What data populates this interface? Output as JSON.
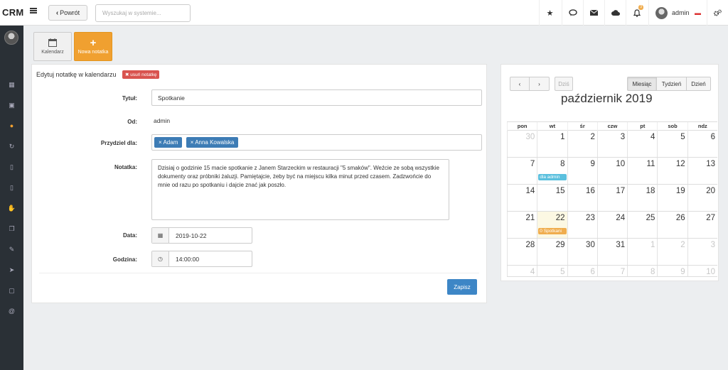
{
  "app": {
    "logo": "CRM"
  },
  "topbar": {
    "back_label": "Powrót",
    "search_placeholder": "Wyszukaj w systemie...",
    "notif_count": "3",
    "user_name": "admin",
    "icons": [
      "star-icon",
      "chat-icon",
      "envelope-icon",
      "cloud-icon",
      "bell-icon",
      "cogs-icon"
    ]
  },
  "tiles": {
    "calendar_label": "Kalendarz",
    "new_note_label": "Nowa notatka"
  },
  "form": {
    "title": "Edytuj notatkę w kalendarzu",
    "delete_label": "✖ usuń notatkę",
    "title_label": "Tytuł:",
    "title_value": "Spotkanie",
    "from_label": "Od:",
    "from_value": "admin",
    "assign_label": "Przydziel dla:",
    "assignees": [
      "Adam",
      "Anna Kowalska"
    ],
    "note_label": "Notatka:",
    "note_value": "Dzisiaj o godzinie 15 macie spotkanie z Janem Starzeckim w restauracji \"5 smaków\". Weźcie ze sobą wszystkie dokumenty oraz próbniki żaluzji. Pamiętajcie, żeby być na miejscu kilka minut przed czasem. Zadzwońcie do mnie od razu po spotkaniu i dajcie znać jak poszło.",
    "date_label": "Data:",
    "date_value": "2019-10-22",
    "time_label": "Godzina:",
    "time_value": "14:00:00",
    "save_label": "Zapisz"
  },
  "calendar": {
    "prev": "‹",
    "next": "›",
    "today_label": "Dziś",
    "views": [
      "Miesiąc",
      "Tydzień",
      "Dzień"
    ],
    "active_view": "Miesiąc",
    "month_title": "październik 2019",
    "weekdays": [
      "pon",
      "wt",
      "śr",
      "czw",
      "pt",
      "sob",
      "ndz"
    ],
    "weeks": [
      [
        "30",
        "1",
        "2",
        "3",
        "4",
        "5",
        "6"
      ],
      [
        "7",
        "8",
        "9",
        "10",
        "11",
        "12",
        "13"
      ],
      [
        "14",
        "15",
        "16",
        "17",
        "18",
        "19",
        "20"
      ],
      [
        "21",
        "22",
        "23",
        "24",
        "25",
        "26",
        "27"
      ],
      [
        "28",
        "29",
        "30",
        "31",
        "1",
        "2",
        "3"
      ],
      [
        "4",
        "5",
        "6",
        "7",
        "8",
        "9",
        "10"
      ]
    ],
    "events": [
      {
        "week": 1,
        "day": 1,
        "label": "dla admin",
        "color": "#5bc0de"
      },
      {
        "week": 3,
        "day": 1,
        "label": "0 Spotkani",
        "color": "#f0ad4e"
      }
    ]
  },
  "colors": {
    "accent_orange": "#f0a030",
    "primary_blue": "#3d86c6",
    "danger": "#d9534f",
    "sidebar_bg": "#2a3036"
  }
}
